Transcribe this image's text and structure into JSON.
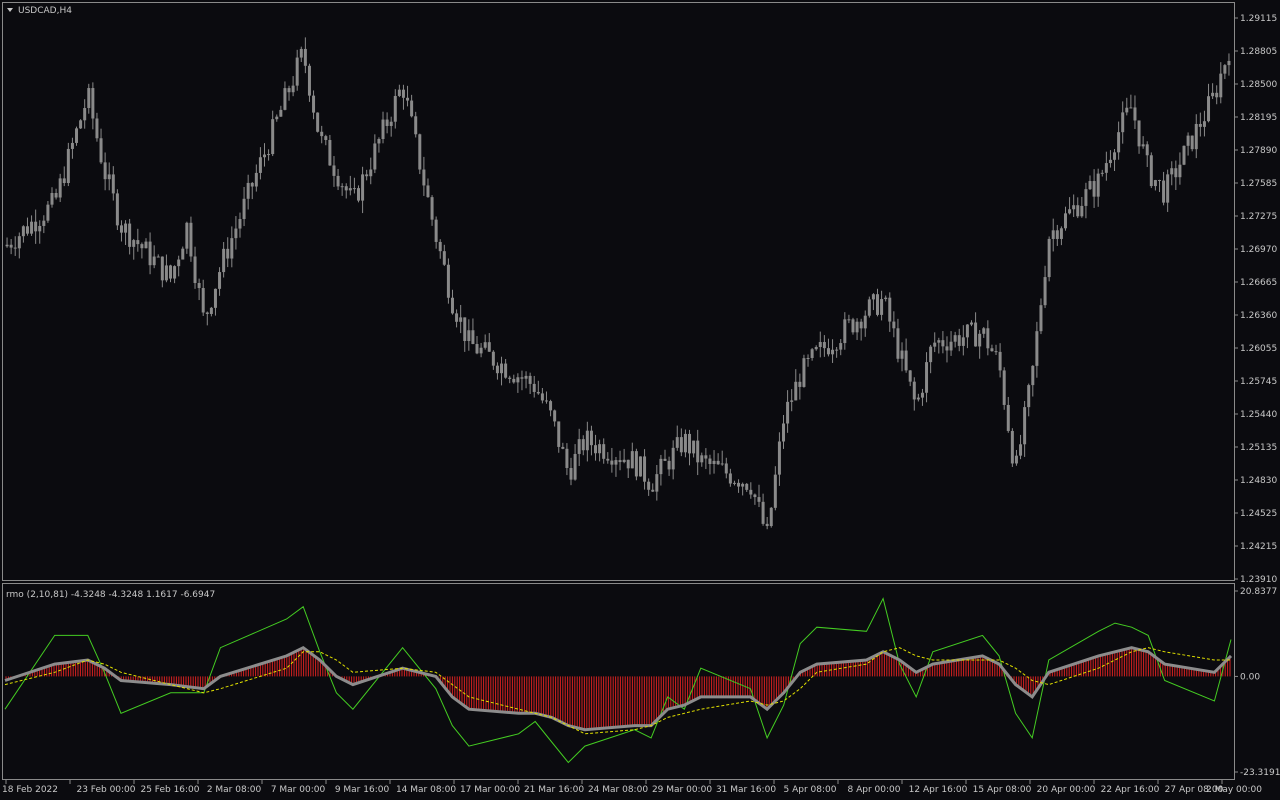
{
  "main_pane": {
    "title": "USDCAD,H4",
    "y_axis_ticks": [
      "1.29115",
      "1.28805",
      "1.28500",
      "1.28195",
      "1.27890",
      "1.27585",
      "1.27275",
      "1.26970",
      "1.26665",
      "1.26360",
      "1.26055",
      "1.25745",
      "1.25440",
      "1.25135",
      "1.24830",
      "1.24525",
      "1.24215",
      "1.23910"
    ]
  },
  "indicator_pane": {
    "label": "rmo (2,10,81) -4.3248 -4.3248 1.1617 -6.6947",
    "y_axis_ticks": [
      "20.8377",
      "0.00",
      "-23.3191"
    ]
  },
  "x_axis_ticks": [
    "18 Feb 2022",
    "23 Feb 00:00",
    "25 Feb 16:00",
    "2 Mar 08:00",
    "7 Mar 00:00",
    "9 Mar 16:00",
    "14 Mar 08:00",
    "17 Mar 00:00",
    "21 Mar 16:00",
    "24 Mar 08:00",
    "29 Mar 00:00",
    "31 Mar 16:00",
    "5 Apr 08:00",
    "8 Apr 00:00",
    "12 Apr 16:00",
    "15 Apr 08:00",
    "20 Apr 00:00",
    "22 Apr 16:00",
    "27 Apr 08:00",
    "2 May 00:00"
  ],
  "colors": {
    "background": "#0b0b0f",
    "candle": "#8a8a8a",
    "histogram": "#d42020",
    "rmo_line": "#8c8c8c",
    "signal_line": "#e0e000",
    "swing_line": "#44cc22",
    "grid_border": "#8a8a8a"
  },
  "chart_data": [
    {
      "type": "candlestick",
      "title": "USDCAD,H4",
      "ylim": [
        1.2391,
        1.2912
      ],
      "price_path": [
        {
          "date": "18 Feb 2022",
          "price": 1.27
        },
        {
          "date": "21 Feb 2022",
          "price": 1.274
        },
        {
          "date": "23 Feb 2022",
          "price": 1.284
        },
        {
          "date": "24 Feb 2022",
          "price": 1.277
        },
        {
          "date": "25 Feb 2022",
          "price": 1.272
        },
        {
          "date": "28 Feb 2022",
          "price": 1.267
        },
        {
          "date": "1 Mar 2022",
          "price": 1.272
        },
        {
          "date": "2 Mar 2022",
          "price": 1.263
        },
        {
          "date": "3 Mar 2022",
          "price": 1.268
        },
        {
          "date": "4 Mar 2022",
          "price": 1.272
        },
        {
          "date": "7 Mar 2022",
          "price": 1.284
        },
        {
          "date": "8 Mar 2022",
          "price": 1.288
        },
        {
          "date": "9 Mar 2022",
          "price": 1.28
        },
        {
          "date": "10 Mar 2022",
          "price": 1.277
        },
        {
          "date": "11 Mar 2022",
          "price": 1.274
        },
        {
          "date": "14 Mar 2022",
          "price": 1.285
        },
        {
          "date": "15 Mar 2022",
          "price": 1.278
        },
        {
          "date": "16 Mar 2022",
          "price": 1.271
        },
        {
          "date": "17 Mar 2022",
          "price": 1.265
        },
        {
          "date": "18 Mar 2022",
          "price": 1.261
        },
        {
          "date": "21 Mar 2022",
          "price": 1.258
        },
        {
          "date": "22 Mar 2022",
          "price": 1.257
        },
        {
          "date": "23 Mar 2022",
          "price": 1.254
        },
        {
          "date": "24 Mar 2022",
          "price": 1.249
        },
        {
          "date": "25 Mar 2022",
          "price": 1.252
        },
        {
          "date": "28 Mar 2022",
          "price": 1.25
        },
        {
          "date": "29 Mar 2022",
          "price": 1.248
        },
        {
          "date": "30 Mar 2022",
          "price": 1.25
        },
        {
          "date": "31 Mar 2022",
          "price": 1.252
        },
        {
          "date": "1 Apr 2022",
          "price": 1.25
        },
        {
          "date": "4 Apr 2022",
          "price": 1.248
        },
        {
          "date": "5 Apr 2022",
          "price": 1.243
        },
        {
          "date": "6 Apr 2022",
          "price": 1.254
        },
        {
          "date": "7 Apr 2022",
          "price": 1.258
        },
        {
          "date": "8 Apr 2022",
          "price": 1.26
        },
        {
          "date": "11 Apr 2022",
          "price": 1.264
        },
        {
          "date": "12 Apr 2022",
          "price": 1.265
        },
        {
          "date": "13 Apr 2022",
          "price": 1.26
        },
        {
          "date": "14 Apr 2022",
          "price": 1.255
        },
        {
          "date": "15 Apr 2022",
          "price": 1.261
        },
        {
          "date": "18 Apr 2022",
          "price": 1.262
        },
        {
          "date": "19 Apr 2022",
          "price": 1.259
        },
        {
          "date": "20 Apr 2022",
          "price": 1.249
        },
        {
          "date": "21 Apr 2022",
          "price": 1.258
        },
        {
          "date": "22 Apr 2022",
          "price": 1.271
        },
        {
          "date": "25 Apr 2022",
          "price": 1.276
        },
        {
          "date": "26 Apr 2022",
          "price": 1.28
        },
        {
          "date": "27 Apr 2022",
          "price": 1.283
        },
        {
          "date": "28 Apr 2022",
          "price": 1.277
        },
        {
          "date": "29 Apr 2022",
          "price": 1.275
        },
        {
          "date": "2 May 2022",
          "price": 1.284
        },
        {
          "date": "3 May 2022",
          "price": 1.289
        }
      ]
    },
    {
      "type": "line",
      "title": "rmo (2,10,81) -4.3248 -4.3248 1.1617 -6.6947",
      "ylim": [
        -23.3191,
        20.8377
      ],
      "series": [
        {
          "key": "swing",
          "color": "#44cc22",
          "values": [
            {
              "date": "18 Feb 2022",
              "value": -8
            },
            {
              "date": "21 Feb 2022",
              "value": 10
            },
            {
              "date": "23 Feb 2022",
              "value": 10
            },
            {
              "date": "24 Feb 2022",
              "value": 1
            },
            {
              "date": "25 Feb 2022",
              "value": -9
            },
            {
              "date": "28 Feb 2022",
              "value": -4
            },
            {
              "date": "2 Mar 2022",
              "value": -4
            },
            {
              "date": "3 Mar 2022",
              "value": 7
            },
            {
              "date": "7 Mar 2022",
              "value": 14
            },
            {
              "date": "8 Mar 2022",
              "value": 17
            },
            {
              "date": "9 Mar 2022",
              "value": 6
            },
            {
              "date": "10 Mar 2022",
              "value": -4
            },
            {
              "date": "11 Mar 2022",
              "value": -8
            },
            {
              "date": "14 Mar 2022",
              "value": 7
            },
            {
              "date": "16 Mar 2022",
              "value": -3
            },
            {
              "date": "17 Mar 2022",
              "value": -12
            },
            {
              "date": "18 Mar 2022",
              "value": -17
            },
            {
              "date": "21 Mar 2022",
              "value": -14
            },
            {
              "date": "22 Mar 2022",
              "value": -11
            },
            {
              "date": "23 Mar 2022",
              "value": -16
            },
            {
              "date": "24 Mar 2022",
              "value": -21
            },
            {
              "date": "25 Mar 2022",
              "value": -17
            },
            {
              "date": "28 Mar 2022",
              "value": -13
            },
            {
              "date": "29 Mar 2022",
              "value": -15
            },
            {
              "date": "30 Mar 2022",
              "value": -5
            },
            {
              "date": "31 Mar 2022",
              "value": -8
            },
            {
              "date": "1 Apr 2022",
              "value": 2
            },
            {
              "date": "4 Apr 2022",
              "value": -3
            },
            {
              "date": "5 Apr 2022",
              "value": -15
            },
            {
              "date": "6 Apr 2022",
              "value": -7
            },
            {
              "date": "7 Apr 2022",
              "value": 8
            },
            {
              "date": "8 Apr 2022",
              "value": 12
            },
            {
              "date": "11 Apr 2022",
              "value": 11
            },
            {
              "date": "12 Apr 2022",
              "value": 19
            },
            {
              "date": "13 Apr 2022",
              "value": 3
            },
            {
              "date": "14 Apr 2022",
              "value": -5
            },
            {
              "date": "15 Apr 2022",
              "value": 6
            },
            {
              "date": "18 Apr 2022",
              "value": 10
            },
            {
              "date": "19 Apr 2022",
              "value": 5
            },
            {
              "date": "20 Apr 2022",
              "value": -9
            },
            {
              "date": "21 Apr 2022",
              "value": -15
            },
            {
              "date": "22 Apr 2022",
              "value": 4
            },
            {
              "date": "25 Apr 2022",
              "value": 11
            },
            {
              "date": "26 Apr 2022",
              "value": 13
            },
            {
              "date": "27 Apr 2022",
              "value": 12
            },
            {
              "date": "28 Apr 2022",
              "value": 10
            },
            {
              "date": "29 Apr 2022",
              "value": -1
            },
            {
              "date": "2 May 2022",
              "value": -6
            },
            {
              "date": "3 May 2022",
              "value": 9
            }
          ]
        },
        {
          "key": "rmo",
          "color": "#8c8c8c",
          "values": [
            {
              "date": "18 Feb 2022",
              "value": -1
            },
            {
              "date": "21 Feb 2022",
              "value": 3
            },
            {
              "date": "23 Feb 2022",
              "value": 4
            },
            {
              "date": "24 Feb 2022",
              "value": 2
            },
            {
              "date": "25 Feb 2022",
              "value": -1
            },
            {
              "date": "28 Feb 2022",
              "value": -2
            },
            {
              "date": "2 Mar 2022",
              "value": -3
            },
            {
              "date": "3 Mar 2022",
              "value": 0
            },
            {
              "date": "7 Mar 2022",
              "value": 5
            },
            {
              "date": "8 Mar 2022",
              "value": 7
            },
            {
              "date": "9 Mar 2022",
              "value": 4
            },
            {
              "date": "10 Mar 2022",
              "value": 0
            },
            {
              "date": "11 Mar 2022",
              "value": -2
            },
            {
              "date": "14 Mar 2022",
              "value": 2
            },
            {
              "date": "16 Mar 2022",
              "value": 0
            },
            {
              "date": "17 Mar 2022",
              "value": -5
            },
            {
              "date": "18 Mar 2022",
              "value": -8
            },
            {
              "date": "21 Mar 2022",
              "value": -9
            },
            {
              "date": "22 Mar 2022",
              "value": -9
            },
            {
              "date": "23 Mar 2022",
              "value": -10
            },
            {
              "date": "24 Mar 2022",
              "value": -12
            },
            {
              "date": "25 Mar 2022",
              "value": -13
            },
            {
              "date": "28 Mar 2022",
              "value": -12
            },
            {
              "date": "29 Mar 2022",
              "value": -12
            },
            {
              "date": "30 Mar 2022",
              "value": -8
            },
            {
              "date": "31 Mar 2022",
              "value": -7
            },
            {
              "date": "1 Apr 2022",
              "value": -5
            },
            {
              "date": "4 Apr 2022",
              "value": -5
            },
            {
              "date": "5 Apr 2022",
              "value": -8
            },
            {
              "date": "6 Apr 2022",
              "value": -4
            },
            {
              "date": "7 Apr 2022",
              "value": 1
            },
            {
              "date": "8 Apr 2022",
              "value": 3
            },
            {
              "date": "11 Apr 2022",
              "value": 4
            },
            {
              "date": "12 Apr 2022",
              "value": 6
            },
            {
              "date": "13 Apr 2022",
              "value": 4
            },
            {
              "date": "14 Apr 2022",
              "value": 1
            },
            {
              "date": "15 Apr 2022",
              "value": 3
            },
            {
              "date": "18 Apr 2022",
              "value": 5
            },
            {
              "date": "19 Apr 2022",
              "value": 3
            },
            {
              "date": "20 Apr 2022",
              "value": -2
            },
            {
              "date": "21 Apr 2022",
              "value": -5
            },
            {
              "date": "22 Apr 2022",
              "value": 1
            },
            {
              "date": "25 Apr 2022",
              "value": 5
            },
            {
              "date": "26 Apr 2022",
              "value": 6
            },
            {
              "date": "27 Apr 2022",
              "value": 7
            },
            {
              "date": "28 Apr 2022",
              "value": 6
            },
            {
              "date": "29 Apr 2022",
              "value": 3
            },
            {
              "date": "2 May 2022",
              "value": 1
            },
            {
              "date": "3 May 2022",
              "value": 5
            }
          ]
        },
        {
          "key": "signal",
          "color": "#e0e000",
          "values": [
            {
              "date": "18 Feb 2022",
              "value": -2
            },
            {
              "date": "21 Feb 2022",
              "value": 1
            },
            {
              "date": "23 Feb 2022",
              "value": 4
            },
            {
              "date": "24 Feb 2022",
              "value": 3
            },
            {
              "date": "25 Feb 2022",
              "value": 1
            },
            {
              "date": "28 Feb 2022",
              "value": -2
            },
            {
              "date": "2 Mar 2022",
              "value": -4
            },
            {
              "date": "3 Mar 2022",
              "value": -3
            },
            {
              "date": "7 Mar 2022",
              "value": 2
            },
            {
              "date": "8 Mar 2022",
              "value": 6
            },
            {
              "date": "9 Mar 2022",
              "value": 6
            },
            {
              "date": "10 Mar 2022",
              "value": 4
            },
            {
              "date": "11 Mar 2022",
              "value": 1
            },
            {
              "date": "14 Mar 2022",
              "value": 2
            },
            {
              "date": "16 Mar 2022",
              "value": 1
            },
            {
              "date": "17 Mar 2022",
              "value": -2
            },
            {
              "date": "18 Mar 2022",
              "value": -5
            },
            {
              "date": "21 Mar 2022",
              "value": -8
            },
            {
              "date": "22 Mar 2022",
              "value": -9
            },
            {
              "date": "23 Mar 2022",
              "value": -10
            },
            {
              "date": "24 Mar 2022",
              "value": -12
            },
            {
              "date": "25 Mar 2022",
              "value": -14
            },
            {
              "date": "28 Mar 2022",
              "value": -13
            },
            {
              "date": "29 Mar 2022",
              "value": -12
            },
            {
              "date": "30 Mar 2022",
              "value": -10
            },
            {
              "date": "31 Mar 2022",
              "value": -9
            },
            {
              "date": "1 Apr 2022",
              "value": -8
            },
            {
              "date": "4 Apr 2022",
              "value": -6
            },
            {
              "date": "5 Apr 2022",
              "value": -7
            },
            {
              "date": "6 Apr 2022",
              "value": -6
            },
            {
              "date": "7 Apr 2022",
              "value": -3
            },
            {
              "date": "8 Apr 2022",
              "value": 1
            },
            {
              "date": "11 Apr 2022",
              "value": 3
            },
            {
              "date": "12 Apr 2022",
              "value": 6
            },
            {
              "date": "13 Apr 2022",
              "value": 7
            },
            {
              "date": "14 Apr 2022",
              "value": 5
            },
            {
              "date": "15 Apr 2022",
              "value": 4
            },
            {
              "date": "18 Apr 2022",
              "value": 4
            },
            {
              "date": "19 Apr 2022",
              "value": 4
            },
            {
              "date": "20 Apr 2022",
              "value": 2
            },
            {
              "date": "21 Apr 2022",
              "value": -1
            },
            {
              "date": "22 Apr 2022",
              "value": -2
            },
            {
              "date": "25 Apr 2022",
              "value": 2
            },
            {
              "date": "26 Apr 2022",
              "value": 4
            },
            {
              "date": "27 Apr 2022",
              "value": 6
            },
            {
              "date": "28 Apr 2022",
              "value": 7
            },
            {
              "date": "29 Apr 2022",
              "value": 6
            },
            {
              "date": "2 May 2022",
              "value": 4
            },
            {
              "date": "3 May 2022",
              "value": 4
            }
          ]
        }
      ]
    }
  ]
}
